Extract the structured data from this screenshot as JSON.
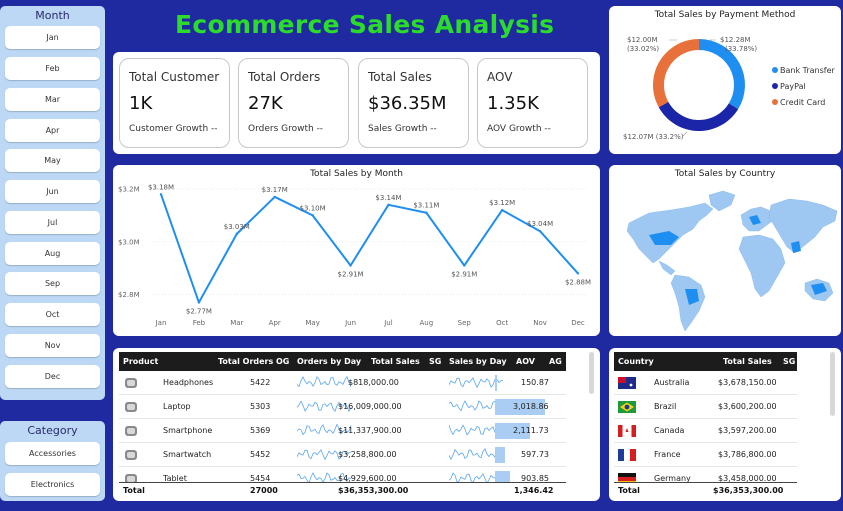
{
  "title": "Ecommerce Sales Analysis",
  "month_slicer": {
    "title": "Month",
    "items": [
      "Jan",
      "Feb",
      "Mar",
      "Apr",
      "May",
      "Jun",
      "Jul",
      "Aug",
      "Sep",
      "Oct",
      "Nov",
      "Dec"
    ]
  },
  "category_slicer": {
    "title": "Category",
    "items": [
      "Accessories",
      "Electronics"
    ]
  },
  "kpis": [
    {
      "label": "Total Customer",
      "value": "1K",
      "growth": "Customer Growth --"
    },
    {
      "label": "Total Orders",
      "value": "27K",
      "growth": "Orders Growth --"
    },
    {
      "label": "Total Sales",
      "value": "$36.35M",
      "growth": "Sales Growth --"
    },
    {
      "label": "AOV",
      "value": "1.35K",
      "growth": "AOV Growth --"
    }
  ],
  "colors": {
    "accent": "#1f8ef1",
    "navy": "#1f2aa0",
    "orange": "#e8703a",
    "title_green": "#2bdc2b"
  },
  "donut": {
    "title": "Total Sales by Payment Method",
    "slices": [
      {
        "name": "Bank Transfer",
        "value": 12.28,
        "label": "$12.28M",
        "pct": "(33.78%)",
        "color": "#1f8ef1"
      },
      {
        "name": "PayPal",
        "value": 12.07,
        "label": "$12.07M (33.2%)",
        "color": "#1a25a8"
      },
      {
        "name": "Credit Card",
        "value": 12.0,
        "label": "$12.00M",
        "pct": "(33.02%)",
        "color": "#e8703a"
      }
    ]
  },
  "chart_data": {
    "type": "line",
    "title": "Total Sales by Month",
    "categories": [
      "Jan",
      "Feb",
      "Mar",
      "Apr",
      "May",
      "Jun",
      "Jul",
      "Aug",
      "Sep",
      "Oct",
      "Nov",
      "Dec"
    ],
    "values": [
      3.18,
      2.77,
      3.03,
      3.17,
      3.1,
      2.91,
      3.14,
      3.11,
      2.91,
      3.12,
      3.04,
      2.88
    ],
    "labels": [
      "$3.18M",
      "$2.77M",
      "$3.03M",
      "$3.17M",
      "$3.10M",
      "$2.91M",
      "$3.14M",
      "$3.11M",
      "$2.91M",
      "$3.12M",
      "$3.04M",
      "$2.88M"
    ],
    "yticks": [
      "$3.2M",
      "$3.0M",
      "$2.8M"
    ],
    "ytick_values": [
      3.2,
      3.0,
      2.8
    ],
    "ylim": [
      2.73,
      3.2
    ],
    "grid": true
  },
  "map": {
    "title": "Total Sales by Country"
  },
  "product_table": {
    "headers": [
      "Product",
      "Total Orders",
      "OG",
      "Orders by Day",
      "Total Sales",
      "SG",
      "Sales by Day",
      "AOV",
      "AG"
    ],
    "rows": [
      {
        "icon": "headphones-icon",
        "product": "Headphones",
        "orders": "5422",
        "sales": "$818,000.00",
        "aov": "150.87",
        "aov_value": 150.87
      },
      {
        "icon": "laptop-icon",
        "product": "Laptop",
        "orders": "5303",
        "sales": "$16,009,000.00",
        "aov": "3,018.86",
        "aov_value": 3018.86
      },
      {
        "icon": "smartphone-icon",
        "product": "Smartphone",
        "orders": "5369",
        "sales": "$11,337,900.00",
        "aov": "2,111.73",
        "aov_value": 2111.73
      },
      {
        "icon": "smartwatch-icon",
        "product": "Smartwatch",
        "orders": "5452",
        "sales": "$3,258,800.00",
        "aov": "597.73",
        "aov_value": 597.73
      },
      {
        "icon": "tablet-icon",
        "product": "Tablet",
        "orders": "5454",
        "sales": "$4,929,600.00",
        "aov": "903.85",
        "aov_value": 903.85
      }
    ],
    "total": {
      "label": "Total",
      "orders": "27000",
      "sales": "$36,353,300.00",
      "aov": "1,346.42"
    }
  },
  "country_table": {
    "headers": [
      "Country",
      "Total Sales",
      "SG"
    ],
    "rows": [
      {
        "flag": "australia-flag-icon",
        "country": "Australia",
        "sales": "$3,678,150.00"
      },
      {
        "flag": "brazil-flag-icon",
        "country": "Brazil",
        "sales": "$3,600,200.00"
      },
      {
        "flag": "canada-flag-icon",
        "country": "Canada",
        "sales": "$3,597,200.00"
      },
      {
        "flag": "france-flag-icon",
        "country": "France",
        "sales": "$3,786,800.00"
      },
      {
        "flag": "germany-flag-icon",
        "country": "Germany",
        "sales": "$3,458,000.00"
      }
    ],
    "total": {
      "label": "Total",
      "sales": "$36,353,300.00"
    }
  }
}
